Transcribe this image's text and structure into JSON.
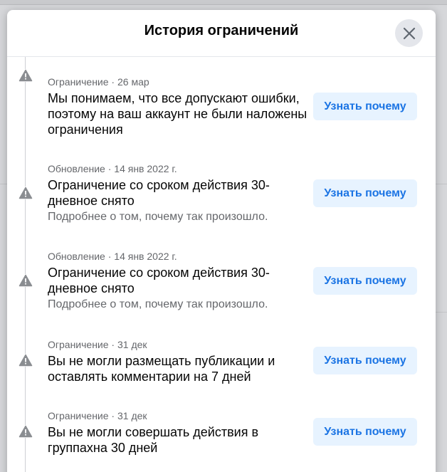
{
  "modal": {
    "title": "История ограничений"
  },
  "entries": [
    {
      "meta": "Ограничение · 26 мар",
      "title": "Мы понимаем, что все допускают ошибки, поэтому на ваш аккаунт не были наложены ограничения",
      "subtitle": "",
      "button": "Узнать почему"
    },
    {
      "meta": "Обновление · 14 янв 2022 г.",
      "title": "Ограничение со сроком действия 30-дневное снято",
      "subtitle": "Подробнее о том, почему так произошло.",
      "button": "Узнать почему"
    },
    {
      "meta": "Обновление · 14 янв 2022 г.",
      "title": "Ограничение со сроком действия 30-дневное снято",
      "subtitle": "Подробнее о том, почему так произошло.",
      "button": "Узнать почему"
    },
    {
      "meta": "Ограничение · 31 дек",
      "title": "Вы не могли размещать публикации и оставлять комментарии на 7 дней",
      "subtitle": "",
      "button": "Узнать почему"
    },
    {
      "meta": "Ограничение · 31 дек",
      "title": "Вы не могли совершать действия в группахна 30 дней",
      "subtitle": "",
      "button": "Узнать почему"
    }
  ],
  "icons": {
    "close": "close-icon",
    "entry": "warning-triangle-icon"
  },
  "colors": {
    "button_bg": "#e7f3ff",
    "button_text": "#1b74e4",
    "icon_gray": "#8a8d91",
    "meta_text": "#65676b"
  }
}
